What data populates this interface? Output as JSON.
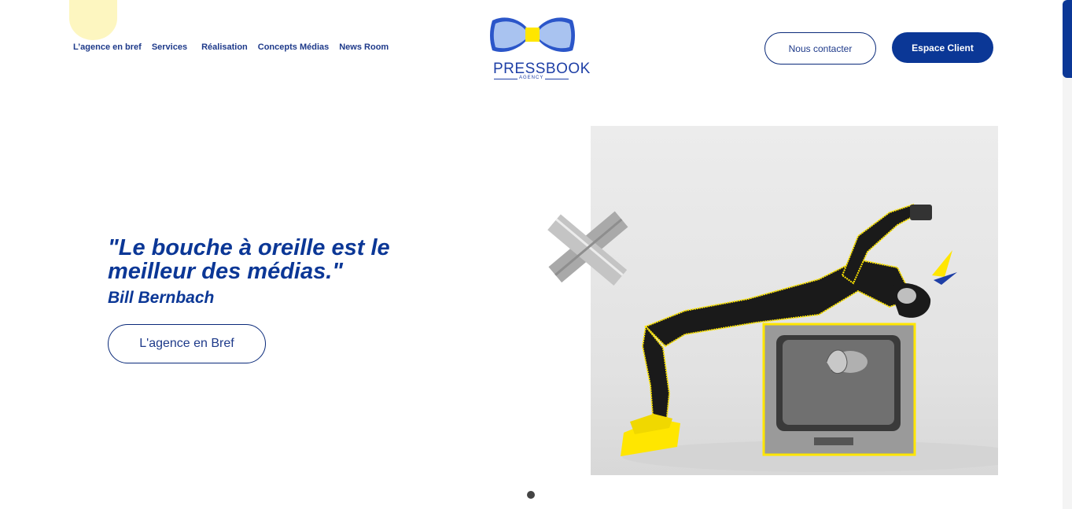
{
  "nav": {
    "items": [
      {
        "label": "L’agence en bref"
      },
      {
        "label": "Services"
      },
      {
        "label": "Réalisation"
      },
      {
        "label": "Concepts Médias"
      },
      {
        "label": "News Room"
      }
    ]
  },
  "logo": {
    "name": "PRESSBOOK",
    "sub": "AGENCY"
  },
  "header": {
    "contact_label": "Nous contacter",
    "client_label": "Espace Client"
  },
  "hero": {
    "quote": "\"Le bouche à oreille est le meilleur des médias.\"",
    "author": "Bill Bernbach",
    "button_label": "L'agence en Bref"
  },
  "colors": {
    "brand_blue": "#0b3796",
    "accent_yellow": "#ffe600",
    "light_yellow": "#fdf6c0"
  },
  "carousel": {
    "active_index": 1,
    "total": 1
  }
}
